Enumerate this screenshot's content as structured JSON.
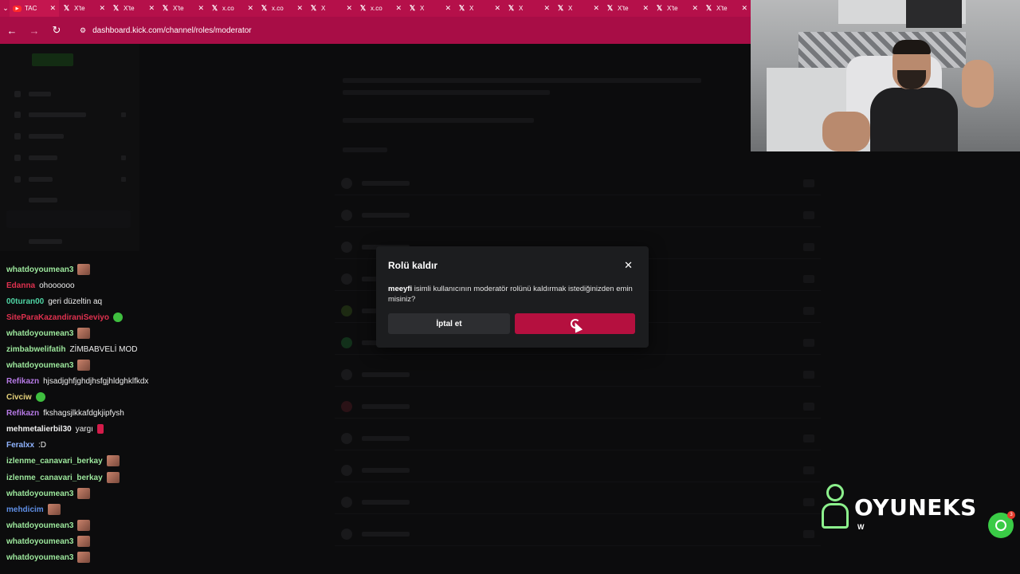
{
  "browser": {
    "tabs": [
      {
        "icon": "youtube",
        "title": "TAC",
        "active": true
      },
      {
        "icon": "x",
        "title": "X'te"
      },
      {
        "icon": "x",
        "title": "X'te"
      },
      {
        "icon": "x",
        "title": "X'te"
      },
      {
        "icon": "x",
        "title": "x.co"
      },
      {
        "icon": "x",
        "title": "x.co"
      },
      {
        "icon": "x",
        "title": "X"
      },
      {
        "icon": "x",
        "title": "x.co"
      },
      {
        "icon": "x",
        "title": "X"
      },
      {
        "icon": "x",
        "title": "X"
      },
      {
        "icon": "x",
        "title": "X"
      },
      {
        "icon": "x",
        "title": "X"
      },
      {
        "icon": "x",
        "title": "X'te"
      },
      {
        "icon": "x",
        "title": "X'te"
      },
      {
        "icon": "x",
        "title": "X'te"
      }
    ],
    "url": "dashboard.kick.com/channel/roles/moderator",
    "accent": "#b5104a"
  },
  "chat": {
    "messages": [
      {
        "user": "whatdoyoumean3",
        "color": "#9de89d",
        "text": "",
        "emote": "face"
      },
      {
        "user": "Edanna",
        "color": "#e0314f",
        "text": "ohoooooo",
        "emote": ""
      },
      {
        "user": "00turan00",
        "color": "#4fd4a4",
        "text": "geri düzeltin aq",
        "emote": ""
      },
      {
        "user": "SiteParaKazandiraniSeviyo",
        "color": "#e0314f",
        "text": "",
        "emote": "green"
      },
      {
        "user": "whatdoyoumean3",
        "color": "#9de89d",
        "text": "",
        "emote": "face"
      },
      {
        "user": "zimbabwelifatih",
        "color": "#9de89d",
        "text": "ZİMBABVELİ MOD",
        "emote": ""
      },
      {
        "user": "whatdoyoumean3",
        "color": "#9de89d",
        "text": "",
        "emote": "face"
      },
      {
        "user": "Refikazn",
        "color": "#b77ae6",
        "text": "hjsadjghfjghdjhsfgjhldghklfkdx",
        "emote": ""
      },
      {
        "user": "Civciw",
        "color": "#e6d27a",
        "text": "",
        "emote": "green"
      },
      {
        "user": "Refikazn",
        "color": "#b77ae6",
        "text": "fkshagsjlkkafdgkjipfysh",
        "emote": ""
      },
      {
        "user": "mehmetalierbil30",
        "color": "#f0f0f0",
        "text": "yargı",
        "emote": "red"
      },
      {
        "user": "Feralxx",
        "color": "#8fb3ff",
        "text": ":D",
        "emote": ""
      },
      {
        "user": "izlenme_canavari_berkay",
        "color": "#9de89d",
        "text": "",
        "emote": "face"
      },
      {
        "user": "izlenme_canavari_berkay",
        "color": "#9de89d",
        "text": "",
        "emote": "face"
      },
      {
        "user": "whatdoyoumean3",
        "color": "#9de89d",
        "text": "",
        "emote": "face"
      },
      {
        "user": "mehdicim",
        "color": "#5f8fe6",
        "text": "",
        "emote": "face"
      },
      {
        "user": "whatdoyoumean3",
        "color": "#9de89d",
        "text": "",
        "emote": "face"
      },
      {
        "user": "whatdoyoumean3",
        "color": "#9de89d",
        "text": "",
        "emote": "face"
      },
      {
        "user": "whatdoyoumean3",
        "color": "#9de89d",
        "text": "",
        "emote": "face"
      }
    ]
  },
  "modal": {
    "title": "Rolü kaldır",
    "body_user": "meeyfi",
    "body_text": " isimli kullanıcının moderatör rolünü kaldırmak istediğinizden emin misiniz?",
    "cancel_label": "İptal et",
    "confirm_color": "#b5103f"
  },
  "overlay": {
    "brand_name": "OYUNEKS",
    "brand_sub": "W",
    "brand_color": "#8cf08c",
    "whatsapp_badge": "3"
  }
}
